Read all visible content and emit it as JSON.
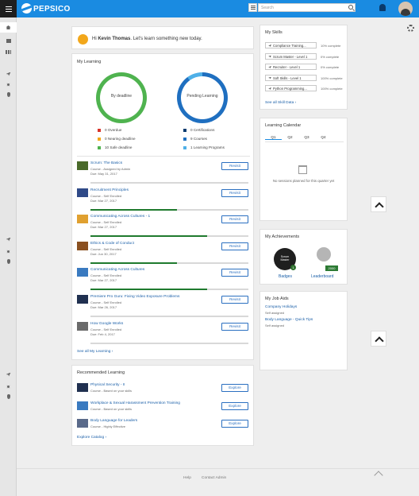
{
  "header": {
    "brand": "PEPSICO",
    "search_placeholder": "Search"
  },
  "welcome": {
    "greeting": "Hi ",
    "name": "Kevin Thomas",
    "rest": ". Let's learn something new today."
  },
  "my_learning": {
    "title": "My Learning",
    "donut1_label": "By deadline",
    "donut2_label": "Pending Learning",
    "legend1": [
      {
        "text": "0 Overdue",
        "color": "#d9342b"
      },
      {
        "text": "0 Nearing deadline",
        "color": "#f2a71b"
      },
      {
        "text": "10 Safe deadline",
        "color": "#4fb34f"
      }
    ],
    "legend2": [
      {
        "text": "0 Certifications",
        "color": "#0b3b6f"
      },
      {
        "text": "9 Courses",
        "color": "#1f6fc0"
      },
      {
        "text": "1 Learning Programs",
        "color": "#4fb0e8"
      }
    ],
    "donut2_share": 0.9,
    "items": [
      {
        "title": "Scrum: The Basics",
        "sub1": "Course - Assigned by Admin",
        "sub2": "Due: May 31, 2017",
        "btn": "Revisit",
        "progress": 0
      },
      {
        "title": "Recruitment Principles",
        "sub1": "Course - Self Enrolled",
        "sub2": "Due: Mar 27, 2017",
        "btn": "Revisit",
        "progress": 0.55
      },
      {
        "title": "Communicating Across Cultures - 1",
        "sub1": "Course - Self Enrolled",
        "sub2": "Due: Mar 27, 2017",
        "btn": "Revisit",
        "progress": 0.74
      },
      {
        "title": "Ethics & Code of Conduct",
        "sub1": "Course - Self Enrolled",
        "sub2": "Due: Jun 30, 2017",
        "btn": "Revisit",
        "progress": 0.55
      },
      {
        "title": "Communicating Across Cultures",
        "sub1": "Course - Self Enrolled",
        "sub2": "Due: Mar 27, 2017",
        "btn": "Revisit",
        "progress": 0.74
      },
      {
        "title": "Premiere Pro Guru: Fixing Video Exposure Problems",
        "sub1": "Course - Self Enrolled",
        "sub2": "Due: Mar 26, 2017",
        "btn": "Revisit",
        "progress": 0
      },
      {
        "title": "How Google Works",
        "sub1": "Course - Self Enrolled",
        "sub2": "Due: Feb 4, 2017",
        "btn": "Revisit",
        "progress": 0
      }
    ],
    "see_all": "See all My Learning ›"
  },
  "recommended": {
    "title": "Recommended Learning",
    "items": [
      {
        "title": "Physical Security - II",
        "sub": "Course - Based on your skills",
        "btn": "Explore"
      },
      {
        "title": "Workplace & Sexual Harassment Prevention Training",
        "sub": "Course - Based on your skills",
        "btn": "Explore"
      },
      {
        "title": "Body Language for Leaders",
        "sub": "Course - Highly Effective",
        "btn": "Explore"
      }
    ],
    "catalog": "Explore Catalog ›"
  },
  "skills": {
    "title": "My Skills",
    "items": [
      {
        "name": "Compliance Training...",
        "pct": "10% complete"
      },
      {
        "name": "Scrum Master - Level 1",
        "pct": "0% complete"
      },
      {
        "name": "Recruiter - Level 1",
        "pct": "0% complete"
      },
      {
        "name": "Soft Skills - Level 1",
        "pct": "100% complete"
      },
      {
        "name": "Python Programming...",
        "pct": "100% complete"
      }
    ],
    "see_all": "See all Skill Data ›"
  },
  "calendar": {
    "title": "Learning Calendar",
    "tabs": [
      "Q1",
      "Q2",
      "Q3",
      "Q4"
    ],
    "empty": "No sessions planned for this quarter yet"
  },
  "achievements": {
    "title": "My Achievements",
    "badges": "Badges",
    "leaderboard": "Leaderboard",
    "badge_text": "Scrum Master",
    "count": "1",
    "points": "2000"
  },
  "job_aids": {
    "title": "My Job Aids",
    "items": [
      {
        "title": "Company Holidays",
        "sub": "Self assigned"
      },
      {
        "title": "Body Language - Quick Tips",
        "sub": "Self assigned"
      }
    ]
  },
  "footer": {
    "help": "Help",
    "contact": "Contact Admin"
  }
}
